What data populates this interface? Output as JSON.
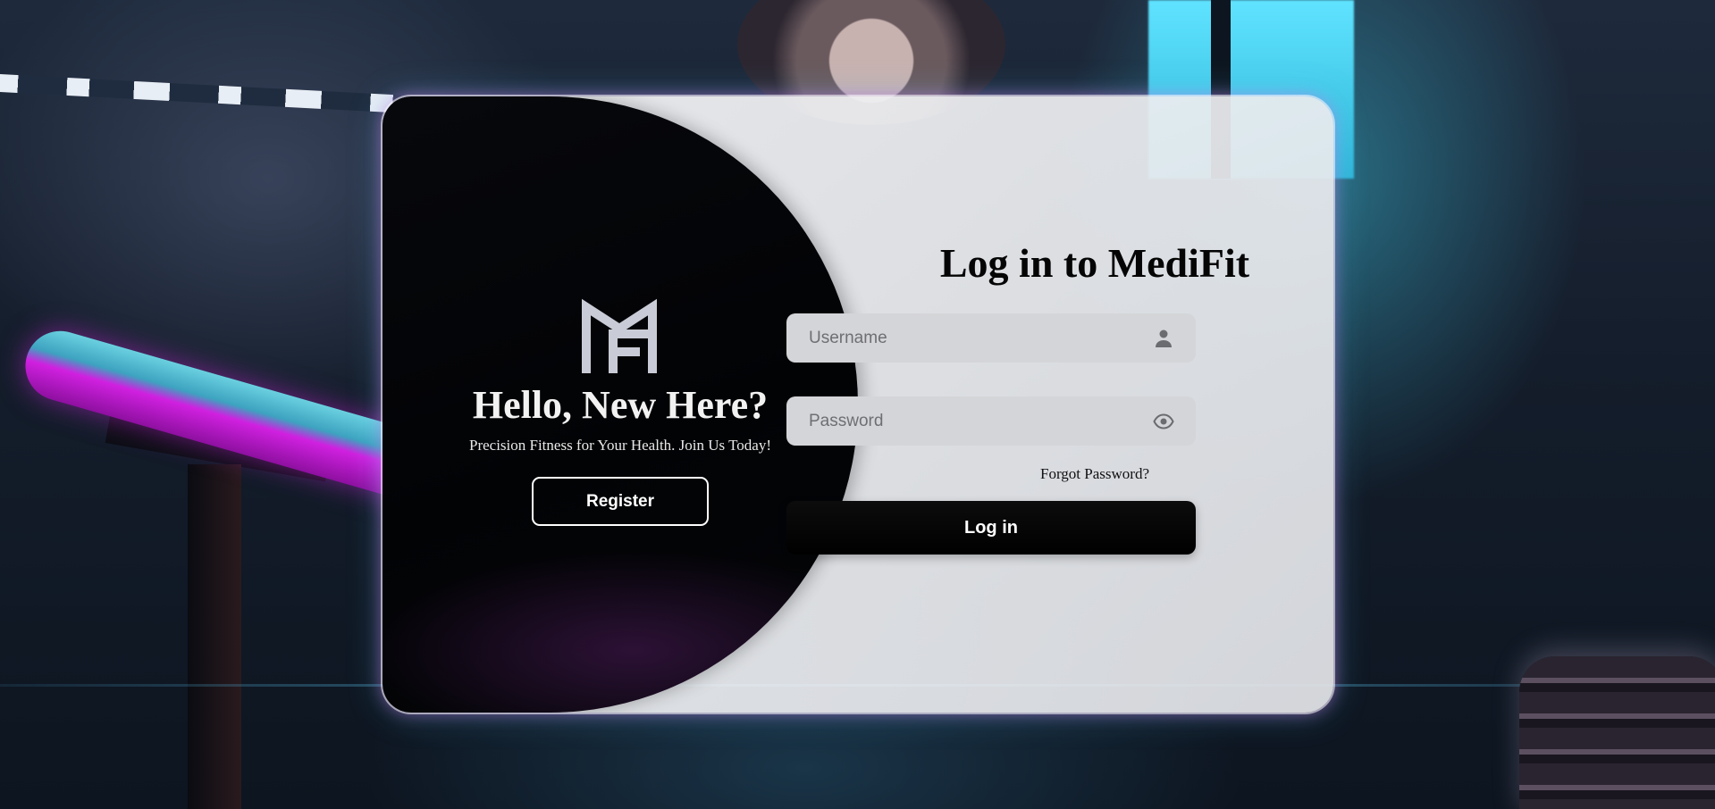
{
  "brand": {
    "logo_icon": "medifit-mf-logo-icon"
  },
  "left_panel": {
    "title": "Hello, New Here?",
    "subtitle": "Precision Fitness for Your Health. Join Us Today!",
    "register_label": "Register"
  },
  "login_form": {
    "title": "Log in to MediFit",
    "username": {
      "value": "",
      "placeholder": "Username",
      "icon": "user-icon"
    },
    "password": {
      "value": "",
      "placeholder": "Password",
      "icon": "eye-icon"
    },
    "forgot_password_label": "Forgot Password?",
    "login_label": "Log in"
  },
  "colors": {
    "left_panel_bg": "#030406",
    "card_bg": "#ebecee",
    "input_bg": "#d4d5d8",
    "primary_button": "#000000",
    "glow_magenta": "#d26ee6",
    "glow_cyan": "#5ac8f0"
  }
}
